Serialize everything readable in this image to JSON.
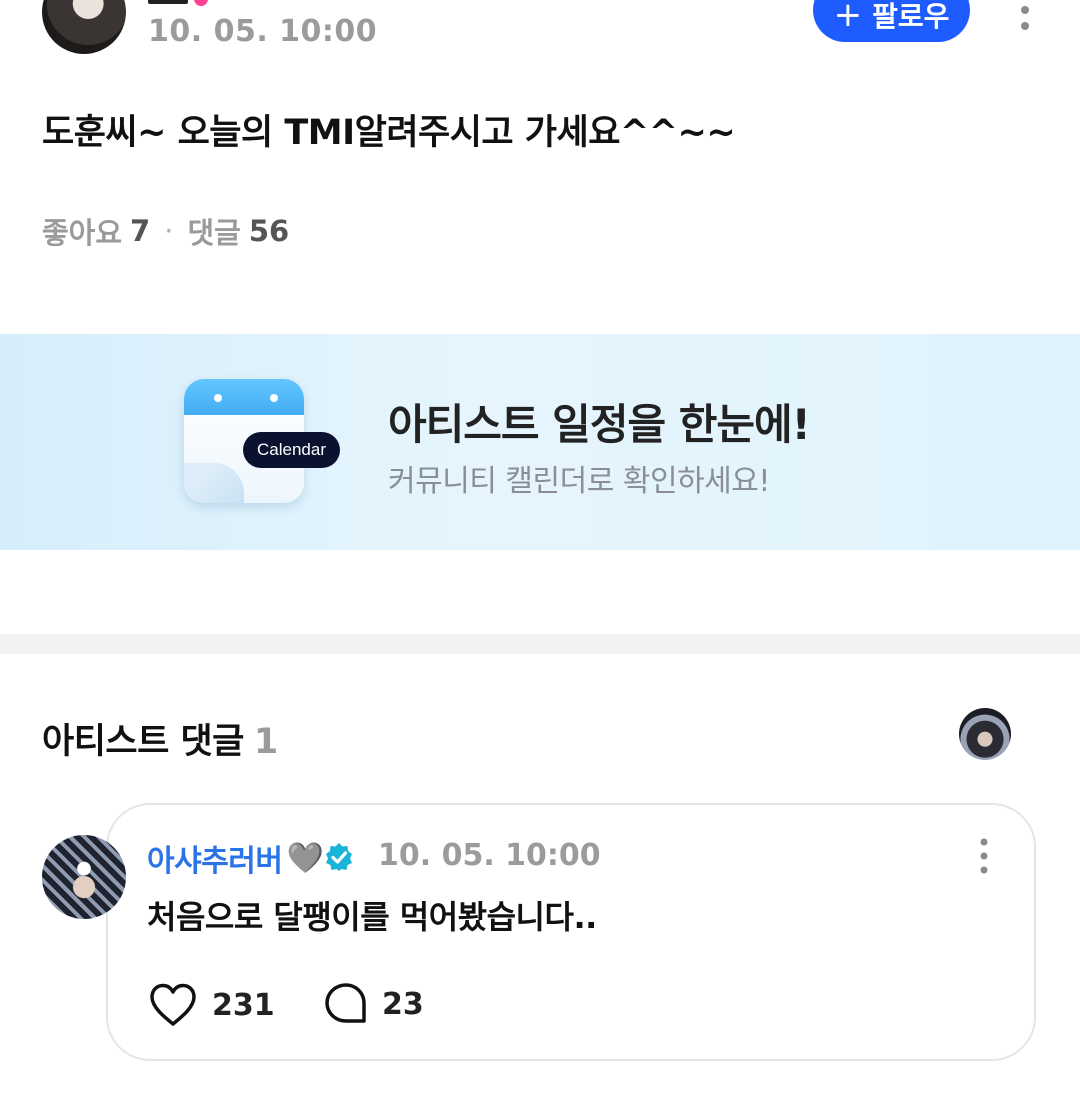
{
  "post": {
    "author_time": "10. 05. 10:00",
    "follow_label": "팔로우",
    "follow_plus": "+",
    "body": "도훈씨~ 오늘의 TMI알려주시고 가세요^^~~",
    "likes_label": "좋아요",
    "likes_count": "7",
    "comments_label": "댓글",
    "comments_count": "56",
    "separator": "·"
  },
  "banner": {
    "tag": "Calendar",
    "title": "아티스트 일정을 한눈에!",
    "subtitle": "커뮤니티 캘린더로 확인하세요!",
    "colors": {
      "bg": "#dff2fc",
      "calendar_header": "#4fb8f8",
      "tag_bg": "#0b1230"
    }
  },
  "artist_comments": {
    "title": "아티스트 댓글",
    "count": "1",
    "items": [
      {
        "author": "아샤추러버",
        "author_heart": "🩶",
        "verified": true,
        "time": "10. 05. 10:00",
        "text": "처음으로 달팽이를 먹어봤습니다..",
        "likes": "231",
        "replies": "23"
      }
    ]
  },
  "icons": {
    "more": "vertical-dots-icon",
    "like": "heart-outline-icon",
    "reply": "speech-bubble-icon",
    "verified": "verified-badge-icon"
  },
  "colors": {
    "accent": "#1f5cff",
    "author_link": "#2a74e8",
    "verified": "#19b4d9",
    "muted": "#9b9b9b"
  }
}
